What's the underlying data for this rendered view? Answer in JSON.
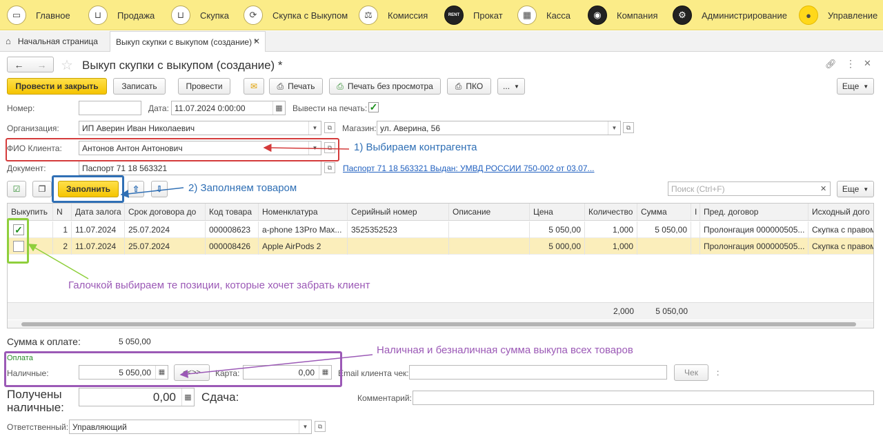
{
  "sections": [
    {
      "label": "Главное",
      "icon": "truck-icon",
      "glyph": "▭"
    },
    {
      "label": "Продажа",
      "icon": "cart-icon",
      "glyph": "⊔"
    },
    {
      "label": "Скупка",
      "icon": "basket-icon",
      "glyph": "⊔"
    },
    {
      "label": "Скупка с Выкупом",
      "icon": "cycle-icon",
      "glyph": "⟳"
    },
    {
      "label": "Комиссия",
      "icon": "scales-icon",
      "glyph": "⚖"
    },
    {
      "label": "Прокат",
      "icon": "rent-icon",
      "glyph": "RENT"
    },
    {
      "label": "Касса",
      "icon": "cashbox-icon",
      "glyph": "▦"
    },
    {
      "label": "Компания",
      "icon": "company-icon",
      "glyph": "◉"
    },
    {
      "label": "Администрирование",
      "icon": "gears-icon",
      "glyph": "⚙"
    },
    {
      "label": "Управление",
      "icon": "management-icon",
      "glyph": "●"
    }
  ],
  "tabs": {
    "home": "Начальная страница",
    "doc": "Выкуп скупки с выкупом (создание) *"
  },
  "title": "Выкуп скупки с выкупом (создание) *",
  "toolbar": {
    "post_close": "Провести и закрыть",
    "save": "Записать",
    "post": "Провести",
    "print": "Печать",
    "print_no_preview": "Печать без просмотра",
    "pko": "ПКО",
    "more": "...",
    "more2": "Еще"
  },
  "form": {
    "number_label": "Номер:",
    "number_value": "",
    "date_label": "Дата:",
    "date_value": "11.07.2024  0:00:00",
    "print_label": "Вывести на печать:",
    "org_label": "Организация:",
    "org_value": "ИП Аверин Иван Николаевич",
    "shop_label": "Магазин:",
    "shop_value": "ул. Аверина, 56",
    "client_label": "ФИО Клиента:",
    "client_value": "Антонов Антон Антонович",
    "doc_label": "Документ:",
    "doc_value": "Паспорт 71 18 563321",
    "doc_link": "Паспорт 71 18 563321 Выдан: УМВД РОССИИ 750-002 от 03.07..."
  },
  "table_toolbar": {
    "fill": "Заполнить",
    "search_placeholder": "Поиск (Ctrl+F)",
    "more": "Еще"
  },
  "columns": [
    "Выкупить",
    "N",
    "Дата залога",
    "Срок договора до",
    "Код товара",
    "Номенклатура",
    "Серийный номер",
    "Описание",
    "Цена",
    "Количество",
    "Сумма",
    "I",
    "Пред. договор",
    "Исходный дого"
  ],
  "rows": [
    {
      "checked": true,
      "n": "1",
      "date": "11.07.2024",
      "due": "25.07.2024",
      "code": "000008623",
      "name": "a-phone 13Pro Max...",
      "serial": "3525352523",
      "desc": "",
      "price": "5 050,00",
      "qty": "1,000",
      "sum": "5 050,00",
      "i": "",
      "prev": "Пролонгация 000000505...",
      "src": "Скупка с правом"
    },
    {
      "checked": false,
      "n": "2",
      "date": "11.07.2024",
      "due": "25.07.2024",
      "code": "000008426",
      "name": "Apple AirPods 2",
      "serial": "",
      "desc": "",
      "price": "5 000,00",
      "qty": "1,000",
      "sum": "",
      "i": "",
      "prev": "Пролонгация 000000505...",
      "src": "Скупка с правом"
    }
  ],
  "totals": {
    "qty": "2,000",
    "sum": "5 050,00"
  },
  "payment": {
    "to_pay_label": "Сумма к оплате:",
    "to_pay_value": "5 050,00",
    "group_label": "Оплата",
    "cash_label": "Наличные:",
    "cash_value": "5 050,00",
    "swap": "<<>>",
    "card_label": "Карта:",
    "card_value": "0,00",
    "email_label": "Email клиента чек:",
    "email_value": "",
    "receipt_button": "Чек",
    "colon": ":",
    "received_label": "Получены наличные:",
    "received_value": "0,00",
    "change_label": "Сдача:",
    "comment_label": "Комментарий:",
    "comment_value": "",
    "responsible_label": "Ответственный:",
    "responsible_value": "Управляющий"
  },
  "annotations": {
    "a1": "1) Выбираем контрагента",
    "a2": "2) Заполняем товаром",
    "a3": "Галочкой выбираем те позиции, которые хочет забрать клиент",
    "a4": "Наличная и безналичная сумма выкупа всех товаров"
  },
  "colors": {
    "red": "#d43a3a",
    "blue": "#2f6fb5",
    "green": "#8fcf3c",
    "purple": "#9b59b6"
  }
}
